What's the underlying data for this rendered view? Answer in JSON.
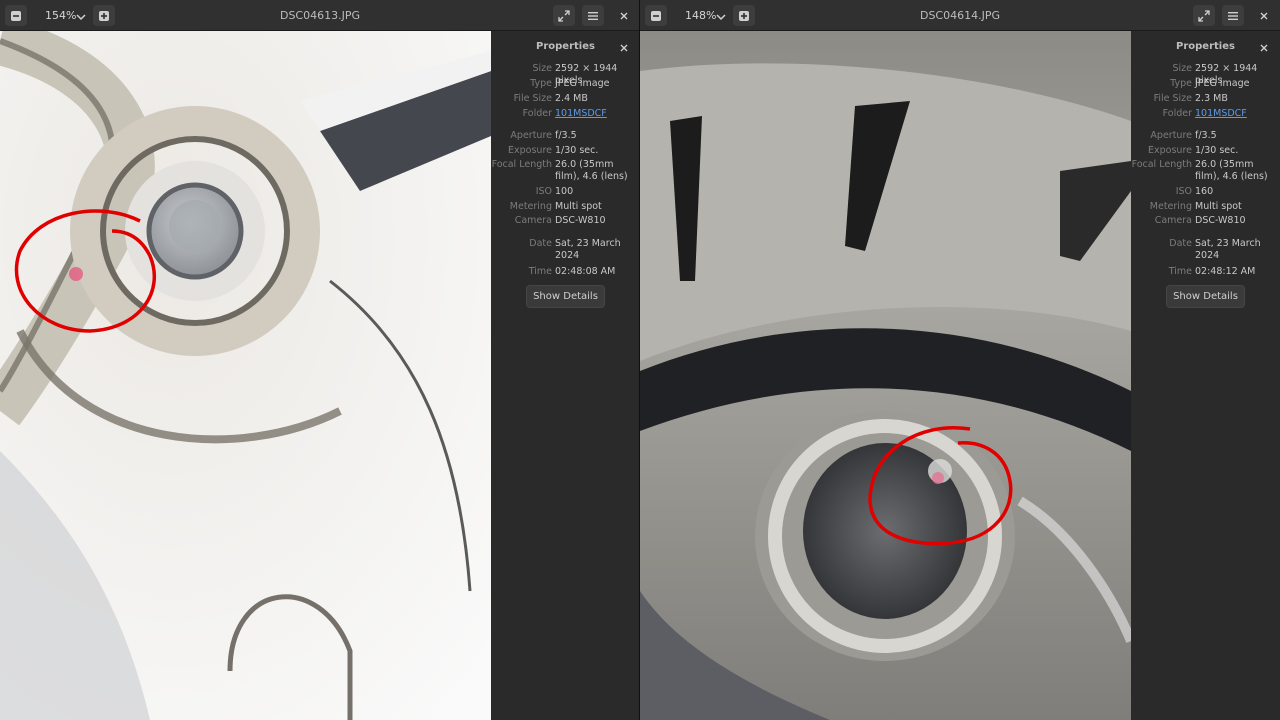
{
  "left": {
    "zoom": "154%",
    "title": "DSC04613.JPG",
    "panel_title": "Properties",
    "properties": {
      "size_label": "Size",
      "size": "2592 × 1944 pixels",
      "type_label": "Type",
      "type": "JPEG image",
      "file_size_label": "File Size",
      "file_size": "2.4 MB",
      "folder_label": "Folder",
      "folder": "101MSDCF",
      "aperture_label": "Aperture",
      "aperture": "f/3.5",
      "exposure_label": "Exposure",
      "exposure": "1/30 sec.",
      "focal_label": "Focal Length",
      "focal": "26.0 (35mm film), 4.6 (lens)",
      "iso_label": "ISO",
      "iso": "100",
      "metering_label": "Metering",
      "metering": "Multi spot",
      "camera_label": "Camera",
      "camera": "DSC-W810",
      "date_label": "Date",
      "date": "Sat, 23 March 2024",
      "time_label": "Time",
      "time": "02:48:08 AM"
    },
    "details_button": "Show Details"
  },
  "right": {
    "zoom": "148%",
    "title": "DSC04614.JPG",
    "panel_title": "Properties",
    "properties": {
      "size_label": "Size",
      "size": "2592 × 1944 pixels",
      "type_label": "Type",
      "type": "JPEG image",
      "file_size_label": "File Size",
      "file_size": "2.3 MB",
      "folder_label": "Folder",
      "folder": "101MSDCF",
      "aperture_label": "Aperture",
      "aperture": "f/3.5",
      "exposure_label": "Exposure",
      "exposure": "1/30 sec.",
      "focal_label": "Focal Length",
      "focal": "26.0 (35mm film), 4.6 (lens)",
      "iso_label": "ISO",
      "iso": "160",
      "metering_label": "Metering",
      "metering": "Multi spot",
      "camera_label": "Camera",
      "camera": "DSC-W810",
      "date_label": "Date",
      "date": "Sat, 23 March 2024",
      "time_label": "Time",
      "time": "02:48:12 AM"
    },
    "details_button": "Show Details"
  },
  "icons": {
    "zoom_out": "minus-box-icon",
    "zoom_in": "plus-box-icon",
    "zoom_dropdown": "chevron-down-icon",
    "fullscreen": "fullscreen-icon",
    "menu": "hamburger-menu-icon",
    "close": "close-icon"
  },
  "colors": {
    "annotation": "#e00000",
    "link": "#5b9be8"
  }
}
